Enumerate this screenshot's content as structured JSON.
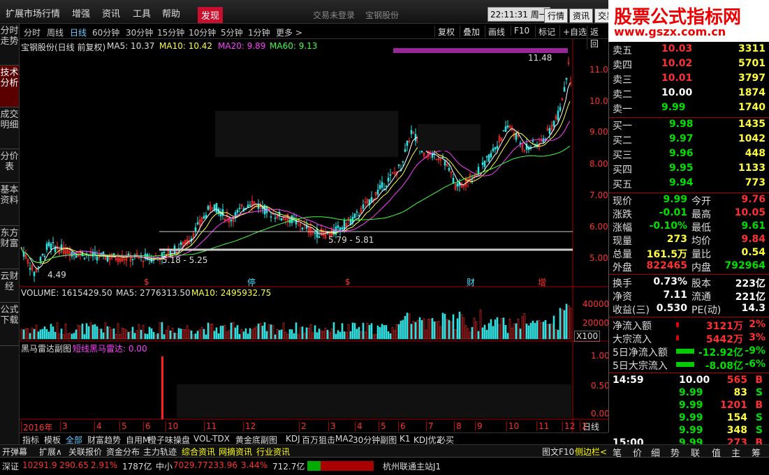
{
  "menu": {
    "items": [
      "扩展市场行情",
      "增强",
      "资讯",
      "工具",
      "帮助"
    ],
    "discover": "发现",
    "login": "交易未登录",
    "stock": "宝钢股份",
    "clock": "22:11:31 周一",
    "right_buttons": [
      "行情",
      "资讯",
      "交易"
    ]
  },
  "brand": {
    "title": "股票公式指标网",
    "url": "www.gszx.com.cn"
  },
  "sidebar": [
    "分时走势",
    "技术分析",
    "成交明细",
    "分价表",
    "基本资料",
    "东方财富",
    "云财经",
    "公式下载"
  ],
  "periods": [
    "分时",
    "周线",
    "日线",
    "60分钟",
    "30分钟",
    "15分钟",
    "10分钟",
    "5分钟",
    "1分钟",
    "更多 >"
  ],
  "toolbar": [
    "复权",
    "叠加",
    "画线",
    "F10",
    "标记",
    "+自选",
    "返回"
  ],
  "chart": {
    "title": "宝钢股份(日线 前复权)",
    "ma5": "MA5: 10.37",
    "ma10": "MA10: 10.42",
    "ma20": "MA20: 9.89",
    "ma60": "MA60: 9.13",
    "yticks": [
      "11.00",
      "10.00",
      "9.00",
      "8.00",
      "7.00",
      "6.00",
      "5.00"
    ],
    "annot": {
      "high": "11.48",
      "range1": "5.79 - 5.81",
      "range2": "5.18 - 5.25",
      "low": "4.49"
    },
    "markers": [
      "$",
      "停",
      "$",
      "财",
      "增"
    ],
    "vol_title": "VOLUME: 1615429.50",
    "vol_ma5": "MA5: 2776313.50",
    "vol_ma10": "MA10: 2495932.75",
    "vol_ticks": [
      "40000",
      "20000"
    ],
    "vol_unit": "X100",
    "ind_title": "黑马雷达副图",
    "ind_sub": "短线黑马雷达: 0.00",
    "ind_ticks": [
      "1.00",
      "0.50",
      "0.00"
    ],
    "dates": [
      "2016年",
      "3",
      "4",
      "5",
      "6",
      "10",
      "11",
      "12",
      "2",
      "3",
      "4",
      "5",
      "6",
      "7",
      "8",
      "9",
      "10",
      "11",
      "12",
      "2"
    ],
    "mode": "日线"
  },
  "indicator_tabs": [
    "指标",
    "模板",
    "全部",
    "财富趋势",
    "自用M",
    "橙子味操盘",
    "VOL-TDX",
    "黄金底副图",
    "KDJ",
    "百万狙击",
    "MA2",
    "30分钟副图",
    "K1",
    "KDJ优2",
    "必买"
  ],
  "bottom_tabs": [
    "开弹幕",
    "扩展∧",
    "关联报价",
    "资金分布",
    "主力轨迹",
    "综合资讯",
    "网摘资讯",
    "行业资讯"
  ],
  "right_tabs": [
    "图文F10",
    "侧边栏<",
    "笔",
    "价",
    "细",
    "势",
    "联",
    "值",
    "主",
    "筹"
  ],
  "quote": {
    "asks": [
      [
        "卖五",
        "10.03",
        "3311"
      ],
      [
        "卖四",
        "10.02",
        "5701"
      ],
      [
        "卖三",
        "10.01",
        "3797"
      ],
      [
        "卖二",
        "10.00",
        "1874"
      ],
      [
        "卖一",
        "9.99",
        "1740"
      ]
    ],
    "bids": [
      [
        "买一",
        "9.98",
        "1435"
      ],
      [
        "买二",
        "9.97",
        "1042"
      ],
      [
        "买三",
        "9.96",
        "448"
      ],
      [
        "买四",
        "9.95",
        "1133"
      ],
      [
        "买五",
        "9.94",
        "773"
      ]
    ],
    "stats": [
      [
        "现价",
        "9.99",
        "今开",
        "9.76"
      ],
      [
        "涨跌",
        "-0.01",
        "最高",
        "10.05"
      ],
      [
        "涨幅",
        "-0.10%",
        "最低",
        "9.61"
      ],
      [
        "现量",
        "273",
        "均价",
        "9.84"
      ],
      [
        "总量",
        "161.5万",
        "量比",
        "0.54"
      ],
      [
        "外盘",
        "822465",
        "内盘",
        "792964"
      ]
    ],
    "fund": [
      [
        "换手",
        "0.73%",
        "股本",
        "223亿"
      ],
      [
        "净资",
        "7.11",
        "流通",
        "221亿"
      ],
      [
        "收益(三)",
        "0.530",
        "PE(动)",
        "14.3"
      ]
    ],
    "flow": [
      [
        "净流入额",
        "3121万",
        "2%"
      ],
      [
        "大宗流入",
        "5442万",
        "3%"
      ],
      [
        "5日净流入额",
        "-12.92亿",
        "-9%"
      ],
      [
        "5日大宗流入",
        "-8.08亿",
        "-6%"
      ]
    ],
    "ticks": [
      [
        "14:59",
        "10.00",
        "565",
        "B"
      ],
      [
        "",
        "9.99",
        "83",
        "S"
      ],
      [
        "",
        "9.99",
        "1201",
        "B"
      ],
      [
        "",
        "9.99",
        "154",
        "S"
      ],
      [
        "",
        "9.99",
        "348",
        "S"
      ],
      [
        "15:00",
        "9.99",
        "273",
        "B"
      ]
    ]
  },
  "status": {
    "sz": "深证",
    "sz_val": "10291.9",
    "sz_chg": "290.65",
    "sz_pct": "2.91%",
    "sz_amt": "1787亿",
    "zx": "中小",
    "zx_val": "7029.77",
    "zx_chg": "233.96",
    "zx_pct": "3.44%",
    "zx_amt": "712.7亿",
    "server": "杭州联通主站J1"
  },
  "chart_data": {
    "type": "candlestick",
    "title": "宝钢股份(日线 前复权)",
    "ylim": [
      4.3,
      11.8
    ],
    "annotations": {
      "high": 11.48,
      "low": 4.49
    }
  }
}
